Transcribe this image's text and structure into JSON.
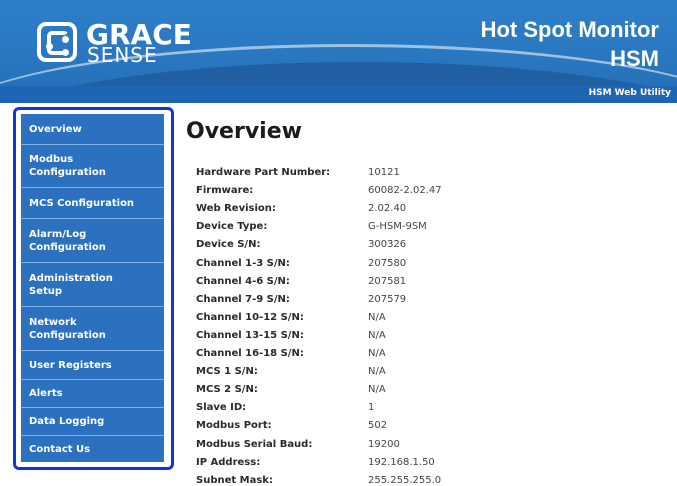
{
  "header": {
    "logo_line1": "GRACE",
    "logo_line2": "SENSE",
    "product_title": "Hot Spot Monitor",
    "product_code": "HSM",
    "utility_label": "HSM Web Utility",
    "brand_color": "#2a78c1",
    "bar_color": "#1e65b4"
  },
  "sidebar": {
    "bg_color": "#2c71c0",
    "frame_color": "#1636d4",
    "items": [
      {
        "label": "Overview",
        "active": true
      },
      {
        "label": "Modbus Configuration"
      },
      {
        "label": "MCS Configuration"
      },
      {
        "label": "Alarm/Log Configuration"
      },
      {
        "label": "Administration Setup"
      },
      {
        "label": "Network Configuration"
      },
      {
        "label": "User Registers"
      },
      {
        "label": "Alerts"
      },
      {
        "label": "Data Logging"
      },
      {
        "label": "Contact Us"
      }
    ]
  },
  "main": {
    "title": "Overview",
    "rows": [
      {
        "label": "Hardware Part Number:",
        "value": "10121"
      },
      {
        "label": "Firmware:",
        "value": "60082-2.02.47"
      },
      {
        "label": "Web Revision:",
        "value": "2.02.40"
      },
      {
        "label": "Device Type:",
        "value": "G-HSM-9SM"
      },
      {
        "label": "Device S/N:",
        "value": "300326"
      },
      {
        "label": "Channel 1-3 S/N:",
        "value": "207580"
      },
      {
        "label": "Channel 4-6 S/N:",
        "value": "207581"
      },
      {
        "label": "Channel 7-9 S/N:",
        "value": "207579"
      },
      {
        "label": "Channel 10-12 S/N:",
        "value": "N/A"
      },
      {
        "label": "Channel 13-15 S/N:",
        "value": "N/A"
      },
      {
        "label": "Channel 16-18 S/N:",
        "value": "N/A"
      },
      {
        "label": "MCS 1 S/N:",
        "value": "N/A"
      },
      {
        "label": "MCS 2 S/N:",
        "value": "N/A"
      },
      {
        "label": "Slave ID:",
        "value": "1"
      },
      {
        "label": "Modbus Port:",
        "value": "502"
      },
      {
        "label": "Modbus Serial Baud:",
        "value": "19200"
      },
      {
        "label": "IP Address:",
        "value": "192.168.1.50"
      },
      {
        "label": "Subnet Mask:",
        "value": "255.255.255.0"
      }
    ]
  }
}
